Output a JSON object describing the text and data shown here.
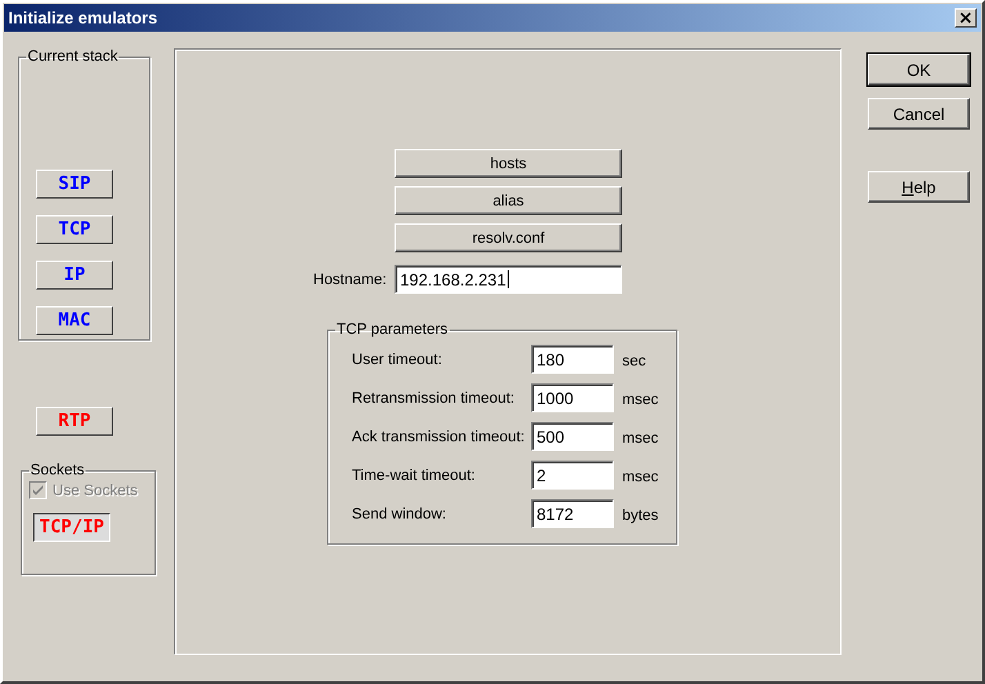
{
  "window": {
    "title": "Initialize emulators",
    "close_label": "×"
  },
  "current_stack": {
    "title": "Current stack",
    "layers": [
      {
        "label": "SIP",
        "color": "#0000ff"
      },
      {
        "label": "TCP",
        "color": "#0000ff"
      },
      {
        "label": "IP",
        "color": "#0000ff"
      },
      {
        "label": "MAC",
        "color": "#0000ff"
      }
    ]
  },
  "rtp_button": {
    "label": "RTP",
    "color": "#ff0000"
  },
  "sockets": {
    "title": "Sockets",
    "use_sockets": {
      "label": "Use Sockets",
      "checked": true,
      "disabled": true
    },
    "button": {
      "label": "TCP/IP",
      "color": "#ff0000",
      "pressed": true
    }
  },
  "file_buttons": [
    "hosts",
    "alias",
    "resolv.conf"
  ],
  "hostname": {
    "label": "Hostname:",
    "value": "192.168.2.231"
  },
  "tcp_parameters": {
    "title": "TCP parameters",
    "rows": [
      {
        "label": "User timeout:",
        "value": "180",
        "unit": "sec"
      },
      {
        "label": "Retransmission timeout:",
        "value": "1000",
        "unit": "msec"
      },
      {
        "label": "Ack transmission timeout:",
        "value": "500",
        "unit": "msec"
      },
      {
        "label": "Time-wait timeout:",
        "value": "2",
        "unit": "msec"
      },
      {
        "label": "Send window:",
        "value": "8172",
        "unit": "bytes"
      }
    ]
  },
  "buttons": [
    {
      "label": "OK",
      "default": true,
      "mnemonic": false
    },
    {
      "label": "Cancel",
      "default": false,
      "mnemonic": false
    },
    {
      "label": "Help",
      "default": false,
      "mnemonic": true
    }
  ]
}
